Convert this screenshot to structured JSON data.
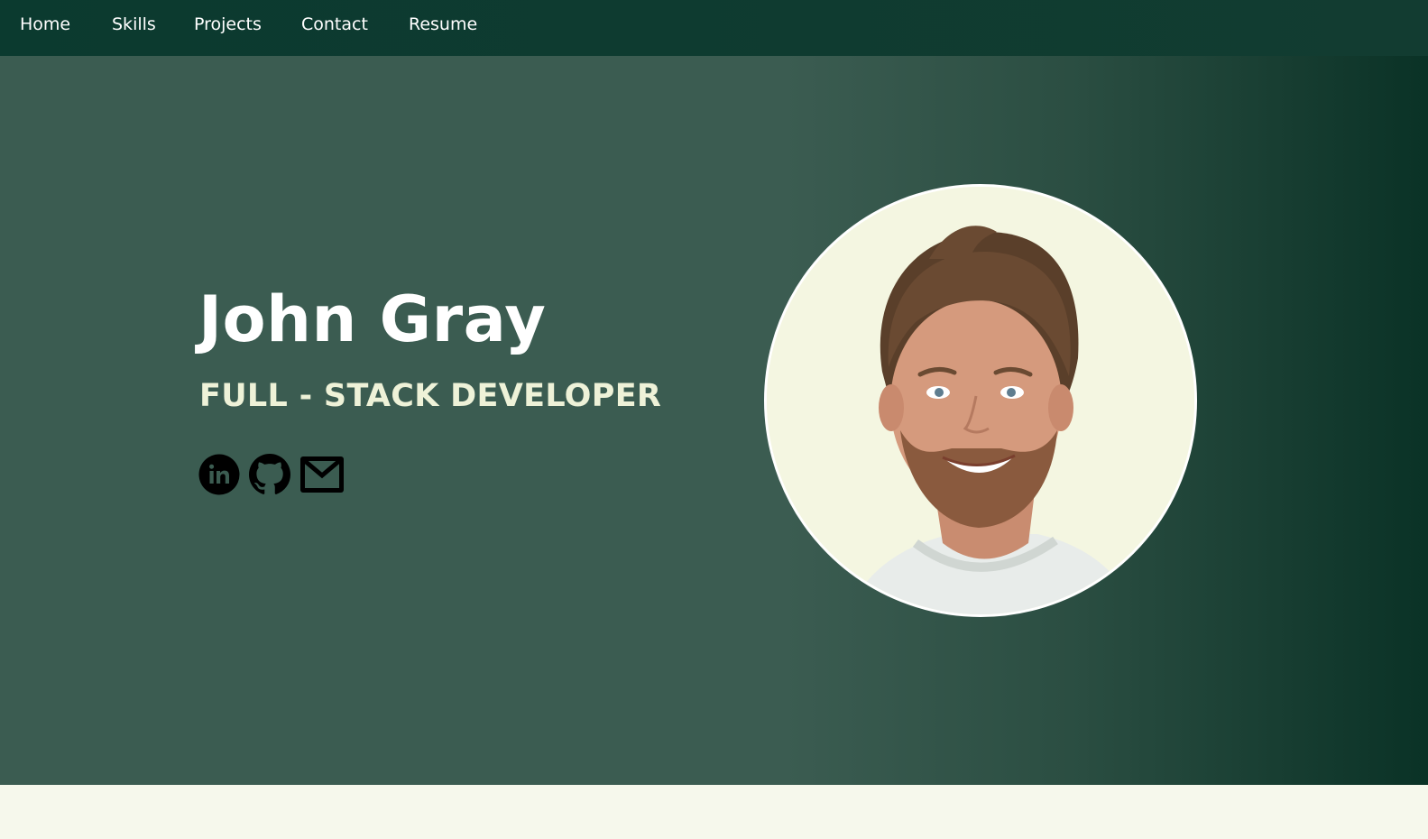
{
  "nav": {
    "items": [
      {
        "label": "Home"
      },
      {
        "label": "Skills"
      },
      {
        "label": "Projects"
      },
      {
        "label": "Contact"
      },
      {
        "label": "Resume"
      }
    ]
  },
  "hero": {
    "name": "John Gray",
    "role": "FULL - STACK DEVELOPER",
    "socials": [
      {
        "icon": "linkedin-icon"
      },
      {
        "icon": "github-icon"
      },
      {
        "icon": "email-icon"
      }
    ],
    "avatar": {
      "icon": "profile-photo"
    }
  },
  "colors": {
    "nav_bg": "#0b3a2f",
    "hero_bg": "#3b5c51",
    "hero_bg_dark": "#0a3226",
    "role_text": "#eef2d8",
    "page_bg": "#f6f8ec"
  }
}
